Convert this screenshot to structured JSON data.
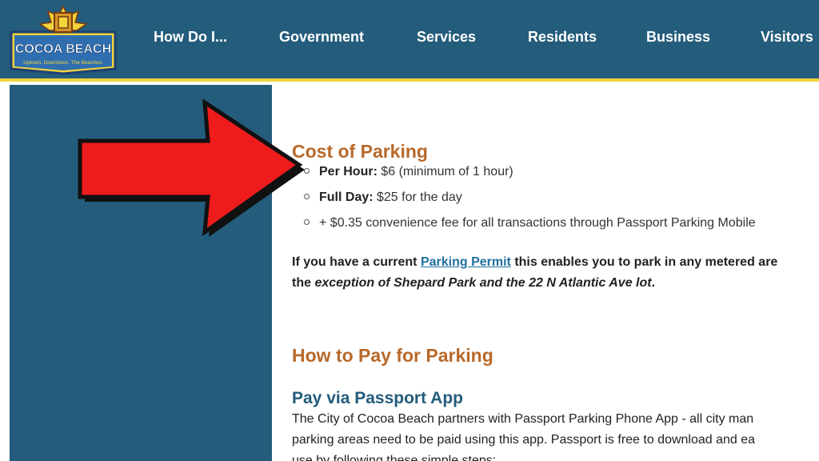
{
  "header": {
    "logo_text": "COCOA BEACH",
    "logo_tagline": "Uptown. Downtown. The Beaches.",
    "nav": [
      "How Do I...",
      "Government",
      "Services",
      "Residents",
      "Business",
      "Visitors"
    ]
  },
  "main": {
    "cost_heading": "Cost of Parking",
    "rates": [
      {
        "label": "Per Hour:",
        "value": " $6 (minimum of 1 hour)"
      },
      {
        "label": "Full Day:",
        "value": " $25 for the day"
      },
      {
        "label": "",
        "value": "+ $0.35 convenience fee for all transactions through Passport Parking Mobile"
      }
    ],
    "permit_pre": "If you have a current ",
    "permit_link": "Parking Permit",
    "permit_post": " this enables you to park in any metered are",
    "permit_line2_pre": "the ",
    "permit_line2_italic": "exception of Shepard Park and the 22 N Atlantic Ave lot",
    "permit_line2_post": ".",
    "pay_heading": "How to Pay for Parking",
    "passport_heading": "Pay via Passport App",
    "passport_line1": "The City of Cocoa Beach partners with Passport Parking Phone App - all city man",
    "passport_line2": "parking areas need to be paid using this app. Passport is free to download and ea",
    "passport_line3": "use by following these simple steps:"
  },
  "colors": {
    "header_bg": "#245c7c",
    "header_border": "#f2d43c",
    "heading_orange": "#b8692a",
    "heading_blue": "#245c7c",
    "arrow_red": "#ee1c1c"
  }
}
